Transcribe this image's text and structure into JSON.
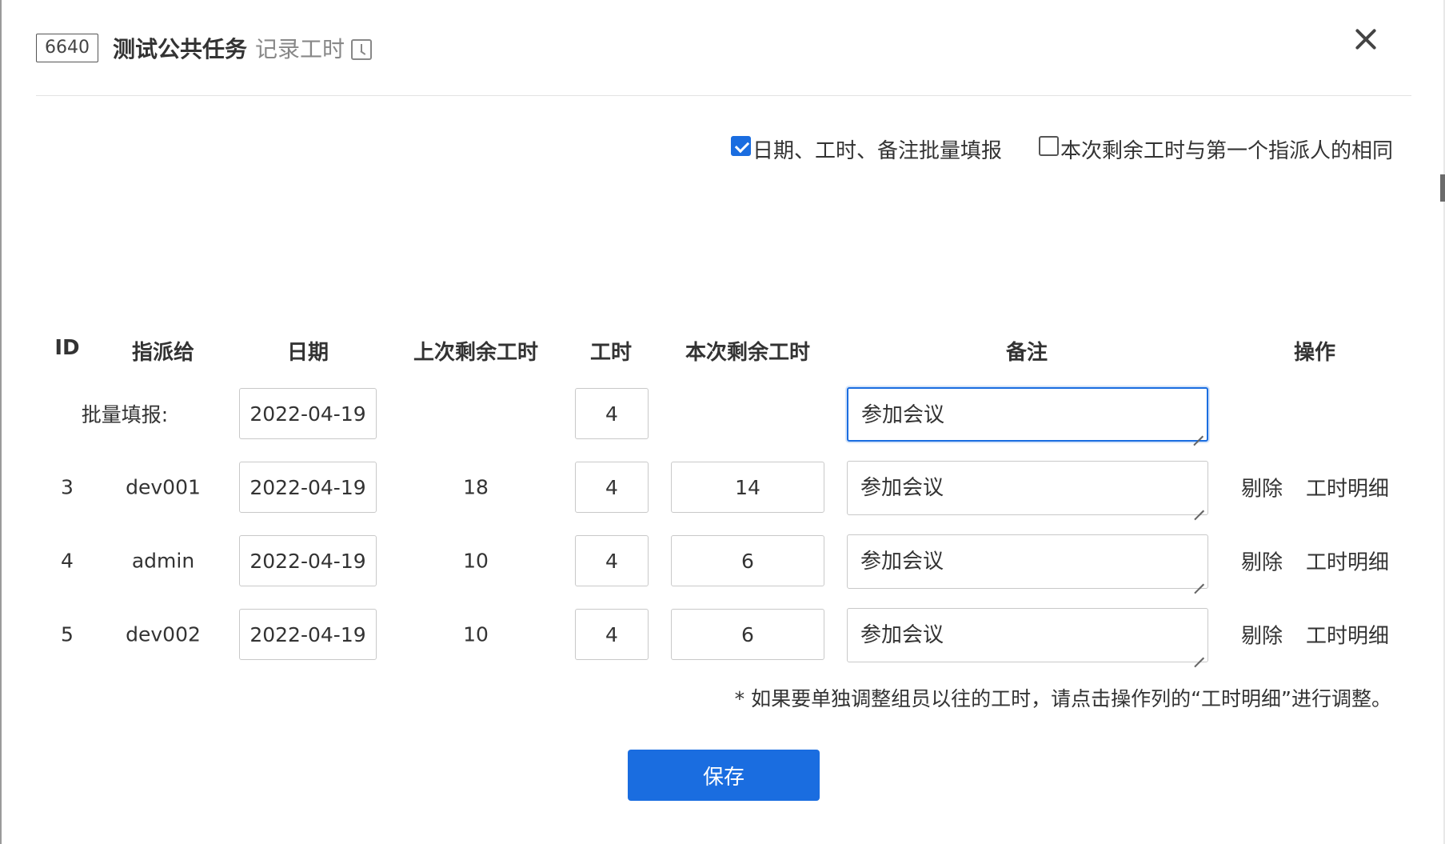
{
  "header": {
    "task_id": "6640",
    "task_title": "测试公共任务",
    "action_title": "记录工时"
  },
  "options": {
    "batch_fill": {
      "label": "日期、工时、备注批量填报",
      "checked": true
    },
    "same_remaining": {
      "label": "本次剩余工时与第一个指派人的相同",
      "checked": false
    }
  },
  "table": {
    "headers": {
      "id": "ID",
      "assignee": "指派给",
      "date": "日期",
      "last_remaining": "上次剩余工时",
      "hours": "工时",
      "remaining": "本次剩余工时",
      "note": "备注",
      "actions": "操作"
    },
    "batch_row": {
      "label": "批量填报:",
      "date": "2022-04-19",
      "hours": "4",
      "note": "参加会议"
    },
    "rows": [
      {
        "id": "3",
        "assignee": "dev001",
        "date": "2022-04-19",
        "last_remaining": "18",
        "hours": "4",
        "remaining": "14",
        "note": "参加会议",
        "remove": "剔除",
        "detail": "工时明细"
      },
      {
        "id": "4",
        "assignee": "admin",
        "date": "2022-04-19",
        "last_remaining": "10",
        "hours": "4",
        "remaining": "6",
        "note": "参加会议",
        "remove": "剔除",
        "detail": "工时明细"
      },
      {
        "id": "5",
        "assignee": "dev002",
        "date": "2022-04-19",
        "last_remaining": "10",
        "hours": "4",
        "remaining": "6",
        "note": "参加会议",
        "remove": "剔除",
        "detail": "工时明细"
      }
    ]
  },
  "footer": {
    "note": "* 如果要单独调整组员以往的工时，请点击操作列的“工时明细”进行调整。",
    "save_label": "保存"
  },
  "colors": {
    "accent": "#1a6de0"
  }
}
